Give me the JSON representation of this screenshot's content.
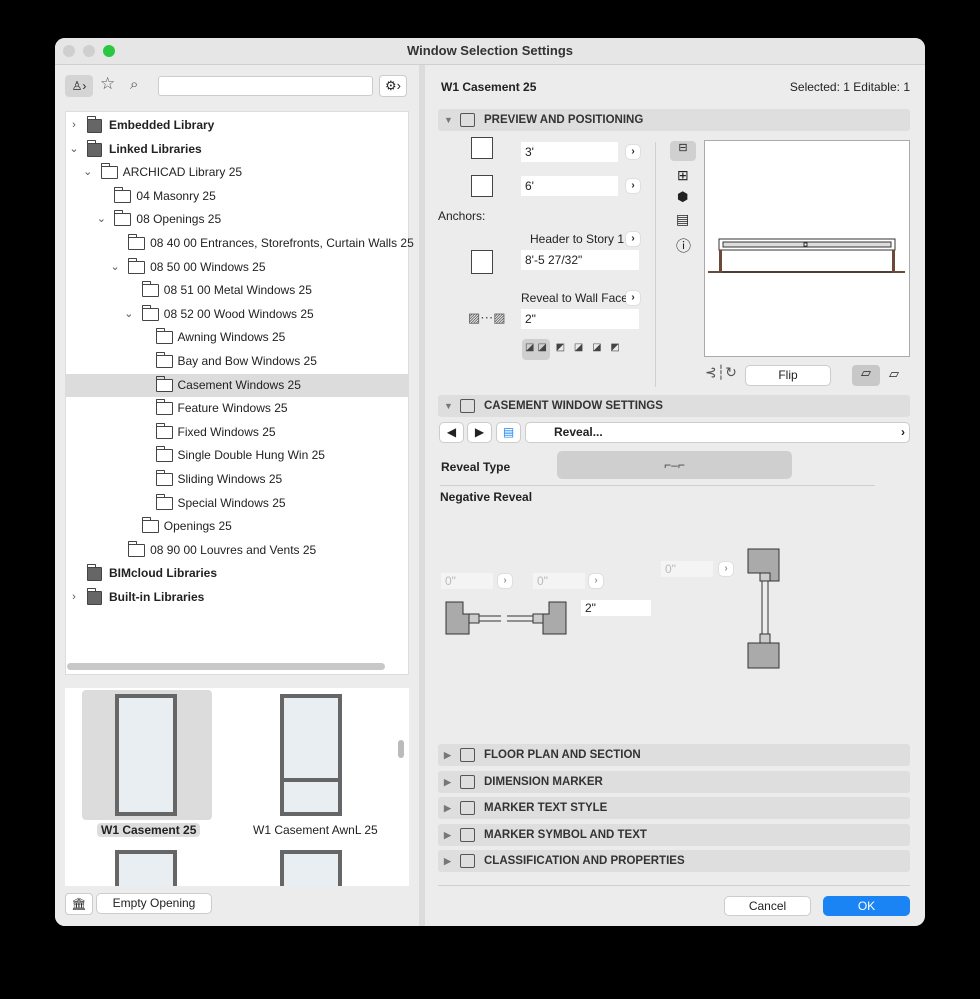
{
  "window": {
    "title": "Window Selection Settings"
  },
  "search": {
    "placeholder": ""
  },
  "tree": [
    {
      "label": "Embedded Library",
      "level": 0,
      "chev": "›",
      "bold": true,
      "kind": "lib"
    },
    {
      "label": "Linked Libraries",
      "level": 0,
      "chev": "⌄",
      "bold": true,
      "kind": "lib"
    },
    {
      "label": "ARCHICAD Library 25",
      "level": 1,
      "chev": "⌄"
    },
    {
      "label": "04 Masonry 25",
      "level": 2,
      "chev": ""
    },
    {
      "label": "08 Openings 25",
      "level": 2,
      "chev": "⌄"
    },
    {
      "label": "08 40 00 Entrances, Storefronts, Curtain Walls 25",
      "level": 3,
      "chev": ""
    },
    {
      "label": "08 50 00 Windows 25",
      "level": 3,
      "chev": "⌄"
    },
    {
      "label": "08 51 00 Metal Windows 25",
      "level": 4,
      "chev": ""
    },
    {
      "label": "08 52 00 Wood Windows 25",
      "level": 4,
      "chev": "⌄"
    },
    {
      "label": "Awning Windows 25",
      "level": 5,
      "chev": ""
    },
    {
      "label": "Bay and Bow Windows 25",
      "level": 5,
      "chev": ""
    },
    {
      "label": "Casement Windows 25",
      "level": 5,
      "chev": "",
      "selected": true
    },
    {
      "label": "Feature Windows 25",
      "level": 5,
      "chev": ""
    },
    {
      "label": "Fixed Windows 25",
      "level": 5,
      "chev": ""
    },
    {
      "label": "Single Double Hung Win 25",
      "level": 5,
      "chev": ""
    },
    {
      "label": "Sliding Windows 25",
      "level": 5,
      "chev": ""
    },
    {
      "label": "Special Windows 25",
      "level": 5,
      "chev": ""
    },
    {
      "label": "Openings 25",
      "level": 4,
      "chev": ""
    },
    {
      "label": "08 90 00 Louvres and Vents 25",
      "level": 3,
      "chev": ""
    },
    {
      "label": "BIMcloud Libraries",
      "level": 0,
      "chev": "",
      "bold": true,
      "kind": "cloud"
    },
    {
      "label": "Built-in Libraries",
      "level": 0,
      "chev": "›",
      "bold": true,
      "kind": "builtin"
    }
  ],
  "thumbs": [
    {
      "label": "W1 Casement 25",
      "selected": true
    },
    {
      "label": "W1 Casement AwnL 25"
    }
  ],
  "empty_opening": "Empty Opening",
  "header": {
    "name": "W1 Casement 25",
    "status": "Selected: 1 Editable: 1"
  },
  "preview": {
    "title": "PREVIEW AND POSITIONING",
    "width": "3'",
    "height": "6'",
    "anchors": "Anchors:",
    "anchor_header": "Header to Story 1",
    "anchor_value": "8'-5 27/32\"",
    "reveal_ref": "Reveal to Wall Face",
    "reveal_value": "2\"",
    "flip": "Flip"
  },
  "casement": {
    "title": "CASEMENT WINDOW SETTINGS",
    "page": "Reveal...",
    "reveal_type": "Reveal Type",
    "negative_reveal": "Negative Reveal",
    "left_val": "0\"",
    "right_val": "0\"",
    "top_val": "0\"",
    "depth_val": "2\""
  },
  "sections": [
    "FLOOR PLAN AND SECTION",
    "DIMENSION MARKER",
    "MARKER TEXT STYLE",
    "MARKER SYMBOL AND TEXT",
    "CLASSIFICATION AND PROPERTIES"
  ],
  "buttons": {
    "cancel": "Cancel",
    "ok": "OK"
  },
  "colors": {
    "accent": "#1a84f5",
    "selected": "#dcdcdc"
  }
}
